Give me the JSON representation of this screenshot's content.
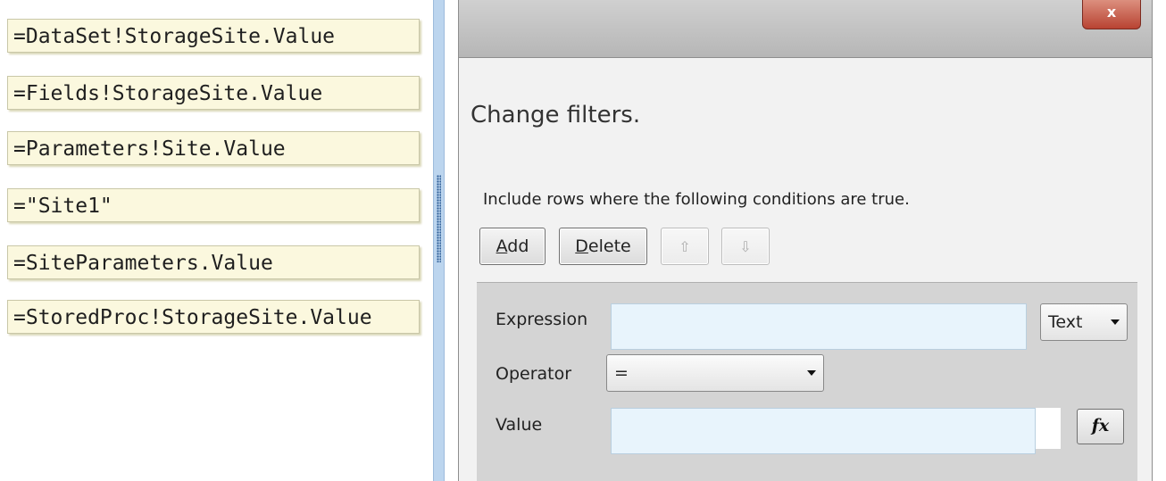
{
  "choices": [
    "=DataSet!StorageSite.Value",
    "=Fields!StorageSite.Value",
    "=Parameters!Site.Value",
    "=\"Site1\"",
    "=SiteParameters.Value",
    "=StoredProc!StorageSite.Value"
  ],
  "dialog": {
    "close_label": "x",
    "heading": "Change filters.",
    "instruction": "Include rows where the following conditions are true.",
    "buttons": {
      "add_underlined": "A",
      "add_rest": "dd",
      "delete_underlined": "D",
      "delete_rest": "elete",
      "move_up": "⇧",
      "move_down": "⇩"
    },
    "fields": {
      "expression_label": "Expression",
      "expression_value": "",
      "type_value": "Text",
      "operator_label": "Operator",
      "operator_value": "=",
      "value_label": "Value",
      "value_value": "",
      "fx_label": "fx"
    }
  }
}
